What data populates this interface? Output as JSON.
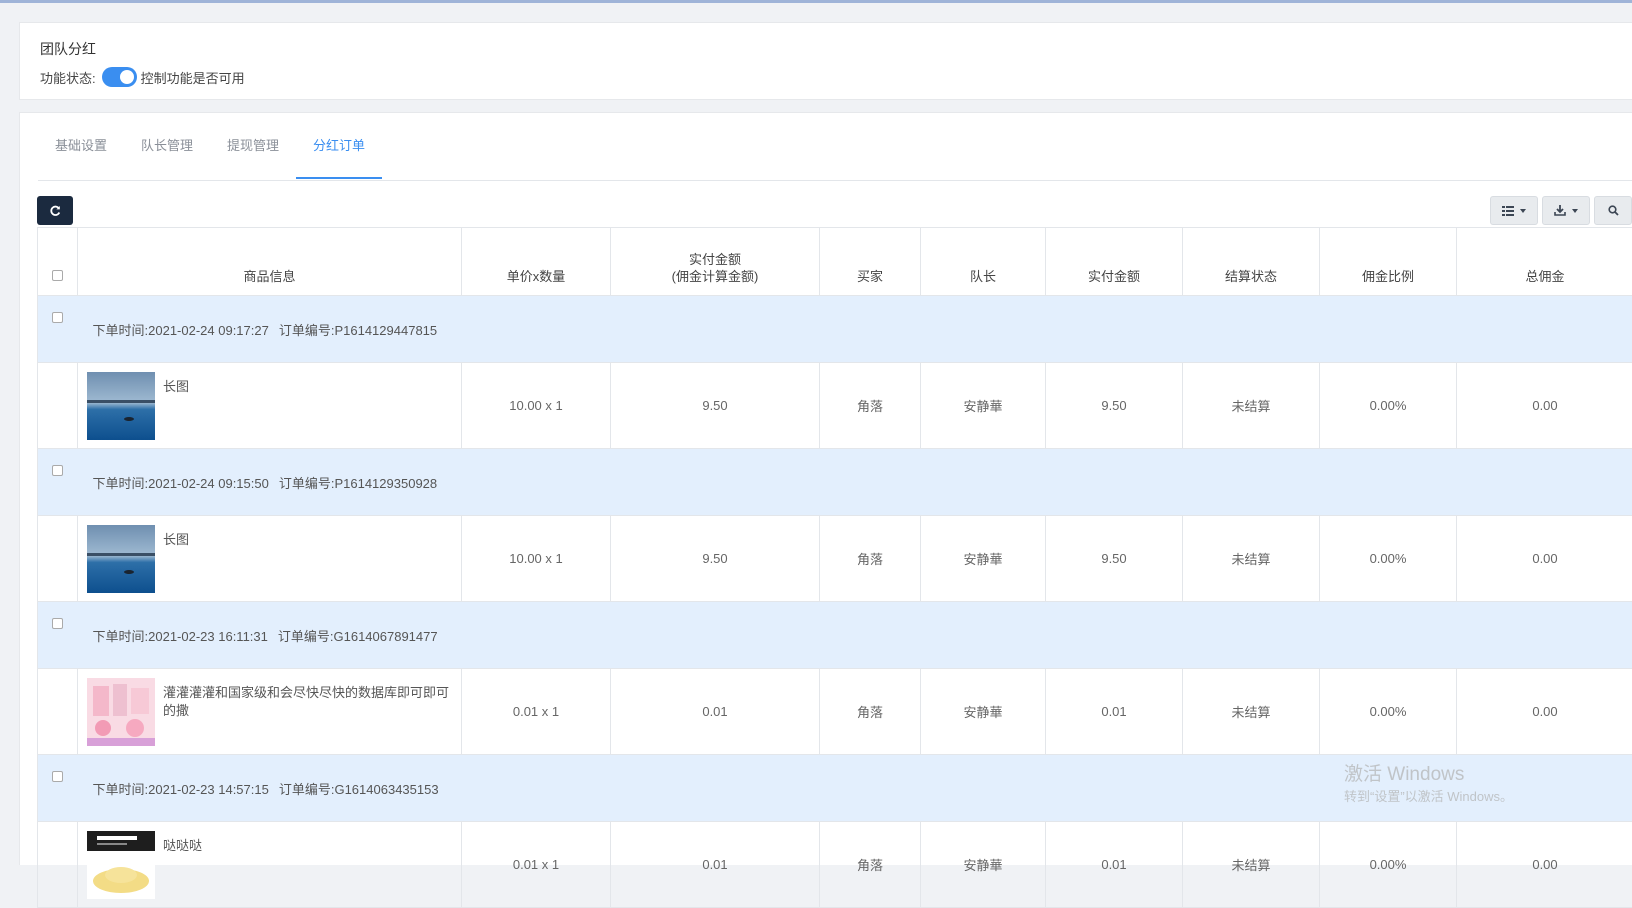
{
  "header": {
    "title": "团队分红",
    "status_label": "功能状态:",
    "status_desc": "控制功能是否可用",
    "enabled": true
  },
  "tabs": [
    {
      "label": "基础设置",
      "active": false
    },
    {
      "label": "队长管理",
      "active": false
    },
    {
      "label": "提现管理",
      "active": false
    },
    {
      "label": "分红订单",
      "active": true
    }
  ],
  "toolbar": {
    "refresh_icon": "refresh-icon",
    "columns_icon": "list-icon",
    "export_icon": "download-icon",
    "search_icon": "search-icon"
  },
  "table": {
    "columns": [
      "商品信息",
      "单价x数量",
      "实付金额\n(佣金计算金额)",
      "买家",
      "队长",
      "实付金额",
      "结算状态",
      "佣金比例",
      "总佣金"
    ],
    "orders": [
      {
        "time_label": "下单时间:",
        "time": "2021-02-24 09:17:27",
        "no_label": "订单编号:",
        "no": "P1614129447815",
        "goods": "长图",
        "thumb": "lake",
        "price_qty": "10.00 x 1",
        "paid_calc": "9.50",
        "buyer": "角落",
        "leader": "安静華",
        "paid": "9.50",
        "status": "未结算",
        "rate": "0.00%",
        "commission": "0.00"
      },
      {
        "time_label": "下单时间:",
        "time": "2021-02-24 09:15:50",
        "no_label": "订单编号:",
        "no": "P1614129350928",
        "goods": "长图",
        "thumb": "lake",
        "price_qty": "10.00 x 1",
        "paid_calc": "9.50",
        "buyer": "角落",
        "leader": "安静華",
        "paid": "9.50",
        "status": "未结算",
        "rate": "0.00%",
        "commission": "0.00"
      },
      {
        "time_label": "下单时间:",
        "time": "2021-02-23 16:11:31",
        "no_label": "订单编号:",
        "no": "G1614067891477",
        "goods": "灌灌灌灌和国家级和会尽快尽快的数据库即可即可的撒",
        "thumb": "pink",
        "price_qty": "0.01 x 1",
        "paid_calc": "0.01",
        "buyer": "角落",
        "leader": "安静華",
        "paid": "0.01",
        "status": "未结算",
        "rate": "0.00%",
        "commission": "0.00"
      },
      {
        "time_label": "下单时间:",
        "time": "2021-02-23 14:57:15",
        "no_label": "订单编号:",
        "no": "G1614063435153",
        "goods": "哒哒哒",
        "thumb": "powder",
        "price_qty": "0.01 x 1",
        "paid_calc": "0.01",
        "buyer": "角落",
        "leader": "安静華",
        "paid": "0.01",
        "status": "未结算",
        "rate": "0.00%",
        "commission": "0.00"
      }
    ]
  },
  "watermark": {
    "line1": "激活 Windows",
    "line2": "转到“设置”以激活 Windows。"
  },
  "colors": {
    "accent": "#3a8ef0",
    "row_head_bg": "#e3effd",
    "dark_button": "#1b2a3f"
  }
}
